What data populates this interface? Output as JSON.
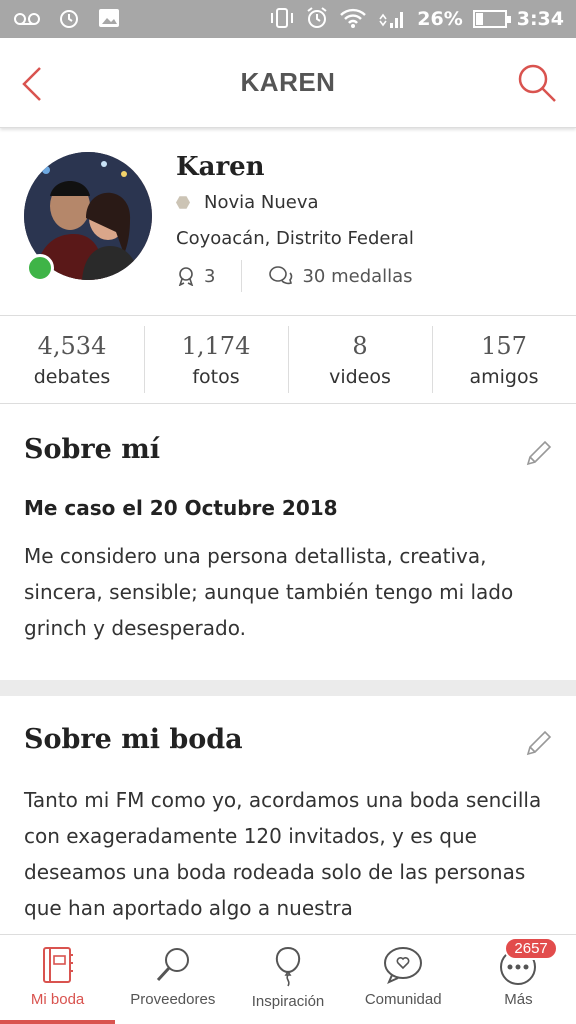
{
  "status_bar": {
    "battery_pct_text": "26%",
    "battery_level": 0.26,
    "time": "3:34"
  },
  "header": {
    "title": "KAREN"
  },
  "profile": {
    "name": "Karen",
    "role": "Novia Nueva",
    "location": "Coyoacán, Distrito Federal",
    "badge_count": "3",
    "medals": "30 medallas",
    "online": true
  },
  "counts": [
    {
      "value": "4,534",
      "label": "debates"
    },
    {
      "value": "1,174",
      "label": "fotos"
    },
    {
      "value": "8",
      "label": "videos"
    },
    {
      "value": "157",
      "label": "amigos"
    }
  ],
  "about": {
    "title": "Sobre mí",
    "subtitle": "Me caso el 20 Octubre 2018",
    "text": "Me considero una persona detallista, creativa, sincera, sensible; aunque también tengo mi lado grinch y desesperado."
  },
  "wedding": {
    "title": "Sobre mi boda",
    "text": "Tanto mi FM como yo, acordamos una boda sencilla con exageradamente 120 invitados, y es que deseamos una boda rodeada solo de las personas que han aportado algo a nuestra"
  },
  "bottom_nav": [
    {
      "label": "Mi boda",
      "icon": "planner-book-icon",
      "active": true
    },
    {
      "label": "Proveedores",
      "icon": "magnifier-icon",
      "active": false
    },
    {
      "label": "Inspiración",
      "icon": "balloon-icon",
      "active": false
    },
    {
      "label": "Comunidad",
      "icon": "chat-heart-icon",
      "active": false
    },
    {
      "label": "Más",
      "icon": "more-dots-icon",
      "active": false,
      "badge": "2657"
    }
  ],
  "colors": {
    "accent": "#d9534f",
    "online": "#3fb447",
    "statusbar": "#a7a7a7"
  }
}
